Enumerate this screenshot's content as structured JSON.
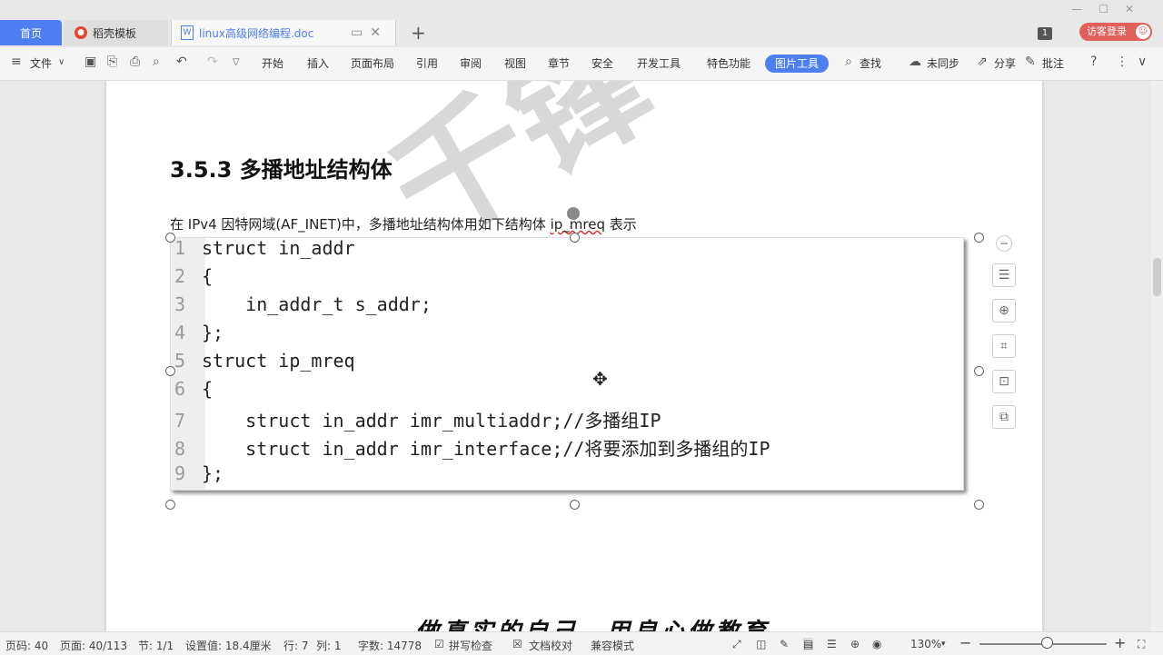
{
  "tabs": {
    "home": "首页",
    "template": "稻壳模板",
    "document": "linux高级网络编程.doc"
  },
  "window": {
    "badge_count": "1",
    "login_label": "访客登录"
  },
  "toolbar": {
    "file": "文件",
    "menus": [
      "开始",
      "插入",
      "页面布局",
      "引用",
      "审阅",
      "视图",
      "章节",
      "安全",
      "开发工具",
      "特色功能"
    ],
    "active_menu": "图片工具",
    "search": "查找",
    "sync": "未同步",
    "share": "分享",
    "comment": "批注"
  },
  "document": {
    "heading": "3.5.3 多播地址结构体",
    "paragraph_pre": "在 IPv4 因特网域(AF_INET)中，多播地址结构体用如下结构体 ",
    "paragraph_code": "ip_mreq",
    "paragraph_post": " 表示",
    "code_lines": [
      {
        "n": "1",
        "text": "struct in_addr"
      },
      {
        "n": "2",
        "text": "{"
      },
      {
        "n": "3",
        "text": "    in_addr_t s_addr;"
      },
      {
        "n": "4",
        "text": "};"
      },
      {
        "n": "5",
        "text": "struct ip_mreq"
      },
      {
        "n": "6",
        "text": "{"
      },
      {
        "n": "7",
        "text": "    struct in_addr imr_multiaddr;//多播组IP"
      },
      {
        "n": "8",
        "text": "    struct in_addr imr_interface;//将要添加到多播组的IP"
      },
      {
        "n": "9",
        "text": "};"
      }
    ],
    "bottom_text": "做真实的自己，用良心做教育"
  },
  "status": {
    "page_code": "页码: 40",
    "page": "页面: 40/113",
    "section": "节: 1/1",
    "setting": "设置值: 18.4厘米",
    "row": "行: 7",
    "col": "列: 1",
    "words": "字数: 14778",
    "spell": "拼写检查",
    "proof": "文档校对",
    "compat": "兼容模式",
    "zoom": "130%"
  },
  "colors": {
    "accent": "#4e7ff0",
    "login": "#e0605c"
  }
}
